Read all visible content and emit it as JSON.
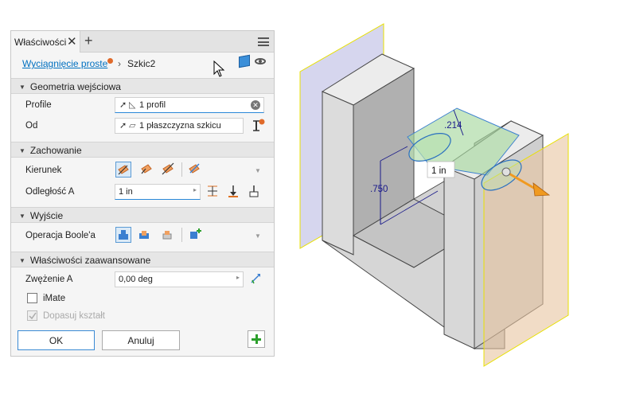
{
  "panel": {
    "tab_title": "Właściwości",
    "tab_close": "✕",
    "tab_add": "+",
    "breadcrumb": {
      "feature": "Wyciągnięcie proste",
      "separator": "›",
      "sketch": "Szkic2"
    }
  },
  "sections": {
    "geometry": {
      "title": "Geometria wejściowa",
      "profile_label": "Profile",
      "profile_value": "1 profil",
      "from_label": "Od",
      "from_value": "1 płaszczyzna szkicu"
    },
    "behavior": {
      "title": "Zachowanie",
      "direction_label": "Kierunek",
      "distance_label": "Odległość A",
      "distance_value": "1 in"
    },
    "output": {
      "title": "Wyjście",
      "boolean_label": "Operacja Boole'a"
    },
    "advanced": {
      "title": "Właściwości zaawansowane",
      "taper_label": "Zwężenie A",
      "taper_value": "0,00 deg",
      "imate_label": "iMate",
      "match_shape_label": "Dopasuj kształt"
    }
  },
  "buttons": {
    "ok": "OK",
    "cancel": "Anuluj"
  },
  "viewport": {
    "dim_vertical": ".750",
    "dim_small": ".214",
    "dim_distance": "1 in"
  },
  "colors": {
    "accent": "#2a88d8",
    "link": "#0070c0",
    "green": "#2ca02c",
    "arrow": "#f09a20"
  }
}
